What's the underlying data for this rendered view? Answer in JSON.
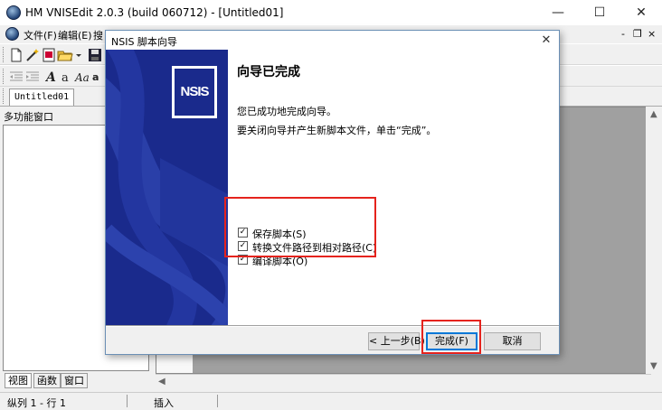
{
  "app": {
    "title": "HM VNISEdit 2.0.3 (build 060712) - [Untitled01]",
    "window_controls": {
      "minimize": "—",
      "maximize": "☐",
      "close": "✕"
    },
    "mdi_controls": {
      "minimize": "-",
      "restore": "❐",
      "close": "×"
    }
  },
  "menubar": {
    "items": [
      {
        "label": "文件(F)"
      },
      {
        "label": "编辑(E)"
      },
      {
        "label": "搜"
      }
    ]
  },
  "document_tab": {
    "label": "Untitled01"
  },
  "side_panel": {
    "title": "多功能窗口",
    "tabs": [
      {
        "label": "视图"
      },
      {
        "label": "函数"
      },
      {
        "label": "窗口"
      }
    ]
  },
  "statusbar": {
    "position": "纵列 1 - 行 1",
    "mode": "插入"
  },
  "wizard": {
    "title": "NSIS 脚本向导",
    "close_glyph": "✕",
    "logo_text": "NSIS",
    "heading": "向导已完成",
    "line1": "您已成功地完成向导。",
    "line2": "要关闭向导并产生新脚本文件，单击“完成”。",
    "options": [
      {
        "label": "保存脚本(S)",
        "checked": true
      },
      {
        "label": "转换文件路径到相对路径(C)",
        "checked": true
      },
      {
        "label": "编译脚本(O)",
        "checked": true
      }
    ],
    "checkmark": "✓",
    "buttons": {
      "back": "< 上一步(B)",
      "finish": "完成(F)",
      "cancel": "取消"
    }
  },
  "colors": {
    "banner": "#1a2a8c",
    "highlight": "#e5231d",
    "focus": "#0078d7",
    "editor_gray": "#a0a0a0"
  }
}
